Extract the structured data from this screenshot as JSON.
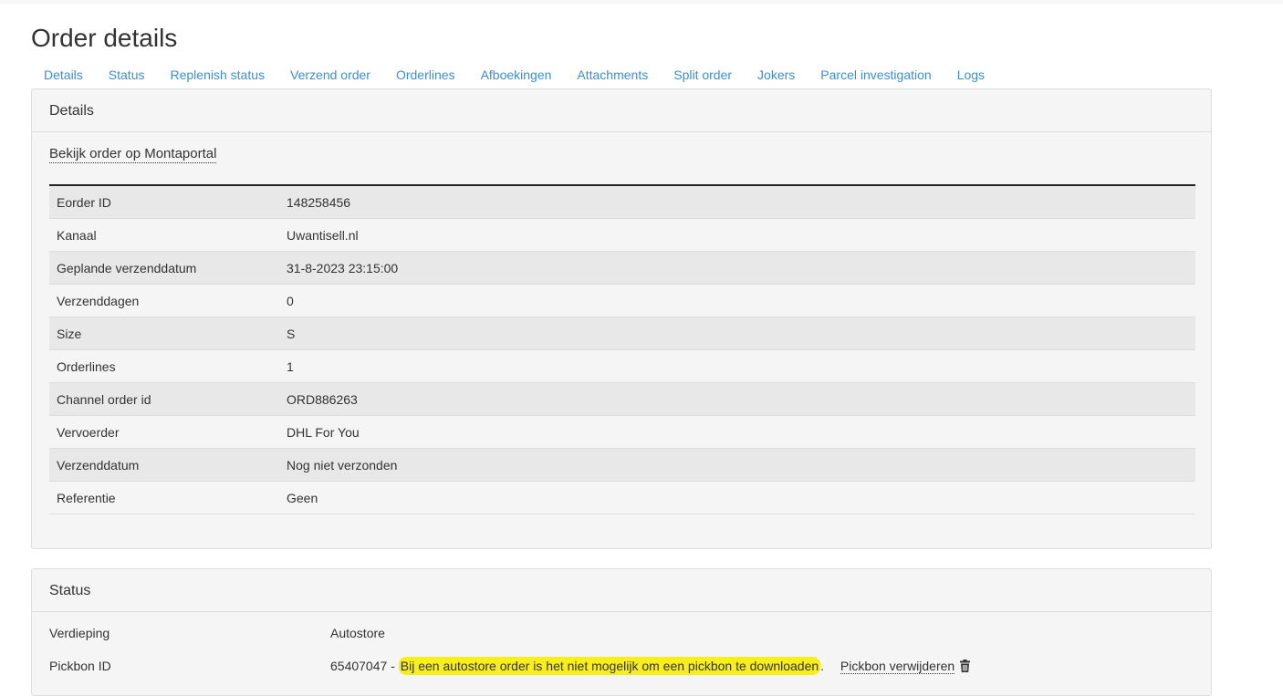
{
  "page": {
    "title": "Order details"
  },
  "tabs": [
    "Details",
    "Status",
    "Replenish status",
    "Verzend order",
    "Orderlines",
    "Afboekingen",
    "Attachments",
    "Split order",
    "Jokers",
    "Parcel investigation",
    "Logs"
  ],
  "details": {
    "heading": "Details",
    "portal_link": "Bekijk order op Montaportal",
    "rows": [
      {
        "label": "Eorder ID",
        "value": "148258456"
      },
      {
        "label": "Kanaal",
        "value": "Uwantisell.nl"
      },
      {
        "label": "Geplande verzenddatum",
        "value": "31-8-2023 23:15:00"
      },
      {
        "label": "Verzenddagen",
        "value": "0"
      },
      {
        "label": "Size",
        "value": "S"
      },
      {
        "label": "Orderlines",
        "value": "1"
      },
      {
        "label": "Channel order id",
        "value": "ORD886263"
      },
      {
        "label": "Vervoerder",
        "value": "DHL For You"
      },
      {
        "label": "Verzenddatum",
        "value": "Nog niet verzonden"
      },
      {
        "label": "Referentie",
        "value": "Geen"
      }
    ]
  },
  "status": {
    "heading": "Status",
    "floor_label": "Verdieping",
    "floor_value": "Autostore",
    "pickbon_label": "Pickbon ID",
    "pickbon_id": "65407047",
    "pickbon_separator": "-",
    "pickbon_message": "Bij een autostore order is het niet mogelijk om een pickbon te downloaden",
    "pickbon_period": ".",
    "remove_label": "Pickbon verwijderen",
    "remove_icon": "trash-icon"
  },
  "colors": {
    "tab_link": "#3a8fd6",
    "highlight": "#f7ee1a"
  }
}
